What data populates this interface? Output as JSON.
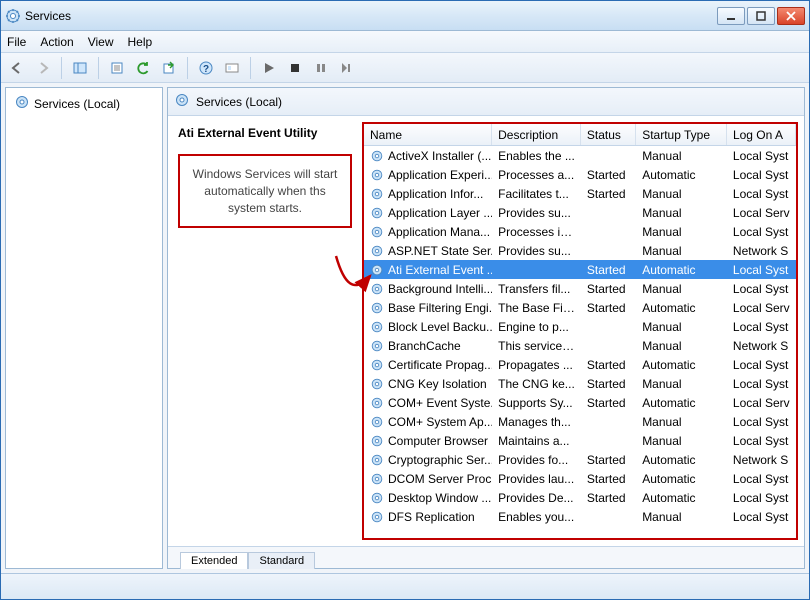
{
  "window": {
    "title": "Services"
  },
  "menu": {
    "file": "File",
    "action": "Action",
    "view": "View",
    "help": "Help"
  },
  "tree": {
    "root": "Services (Local)"
  },
  "header": {
    "label": "Services (Local)"
  },
  "detail": {
    "title": "Ati External Event Utility",
    "annotation": "Windows Services will start automatically when ths system starts."
  },
  "columns": {
    "name": "Name",
    "description": "Description",
    "status": "Status",
    "startup": "Startup Type",
    "logon": "Log On A"
  },
  "services": [
    {
      "name": "ActiveX Installer (...",
      "desc": "Enables the ...",
      "status": "",
      "startup": "Manual",
      "logon": "Local Syst"
    },
    {
      "name": "Application Experi...",
      "desc": "Processes a...",
      "status": "Started",
      "startup": "Automatic",
      "logon": "Local Syst"
    },
    {
      "name": "Application Infor...",
      "desc": "Facilitates t...",
      "status": "Started",
      "startup": "Manual",
      "logon": "Local Syst"
    },
    {
      "name": "Application Layer ...",
      "desc": "Provides su...",
      "status": "",
      "startup": "Manual",
      "logon": "Local Serv"
    },
    {
      "name": "Application Mana...",
      "desc": "Processes in...",
      "status": "",
      "startup": "Manual",
      "logon": "Local Syst"
    },
    {
      "name": "ASP.NET State Ser...",
      "desc": "Provides su...",
      "status": "",
      "startup": "Manual",
      "logon": "Network S"
    },
    {
      "name": "Ati External Event ...",
      "desc": "",
      "status": "Started",
      "startup": "Automatic",
      "logon": "Local Syst",
      "selected": true
    },
    {
      "name": "Background Intelli...",
      "desc": "Transfers fil...",
      "status": "Started",
      "startup": "Manual",
      "logon": "Local Syst"
    },
    {
      "name": "Base Filtering Engi...",
      "desc": "The Base Fil...",
      "status": "Started",
      "startup": "Automatic",
      "logon": "Local Serv"
    },
    {
      "name": "Block Level Backu...",
      "desc": "Engine to p...",
      "status": "",
      "startup": "Manual",
      "logon": "Local Syst"
    },
    {
      "name": "BranchCache",
      "desc": "This service ...",
      "status": "",
      "startup": "Manual",
      "logon": "Network S"
    },
    {
      "name": "Certificate Propag...",
      "desc": "Propagates ...",
      "status": "Started",
      "startup": "Automatic",
      "logon": "Local Syst"
    },
    {
      "name": "CNG Key Isolation",
      "desc": "The CNG ke...",
      "status": "Started",
      "startup": "Manual",
      "logon": "Local Syst"
    },
    {
      "name": "COM+ Event Syste...",
      "desc": "Supports Sy...",
      "status": "Started",
      "startup": "Automatic",
      "logon": "Local Serv"
    },
    {
      "name": "COM+ System Ap...",
      "desc": "Manages th...",
      "status": "",
      "startup": "Manual",
      "logon": "Local Syst"
    },
    {
      "name": "Computer Browser",
      "desc": "Maintains a...",
      "status": "",
      "startup": "Manual",
      "logon": "Local Syst"
    },
    {
      "name": "Cryptographic Ser...",
      "desc": "Provides fo...",
      "status": "Started",
      "startup": "Automatic",
      "logon": "Network S"
    },
    {
      "name": "DCOM Server Proc...",
      "desc": "Provides lau...",
      "status": "Started",
      "startup": "Automatic",
      "logon": "Local Syst"
    },
    {
      "name": "Desktop Window ...",
      "desc": "Provides De...",
      "status": "Started",
      "startup": "Automatic",
      "logon": "Local Syst"
    },
    {
      "name": "DFS Replication",
      "desc": "Enables you...",
      "status": "",
      "startup": "Manual",
      "logon": "Local Syst"
    }
  ],
  "tabs": {
    "extended": "Extended",
    "standard": "Standard"
  }
}
